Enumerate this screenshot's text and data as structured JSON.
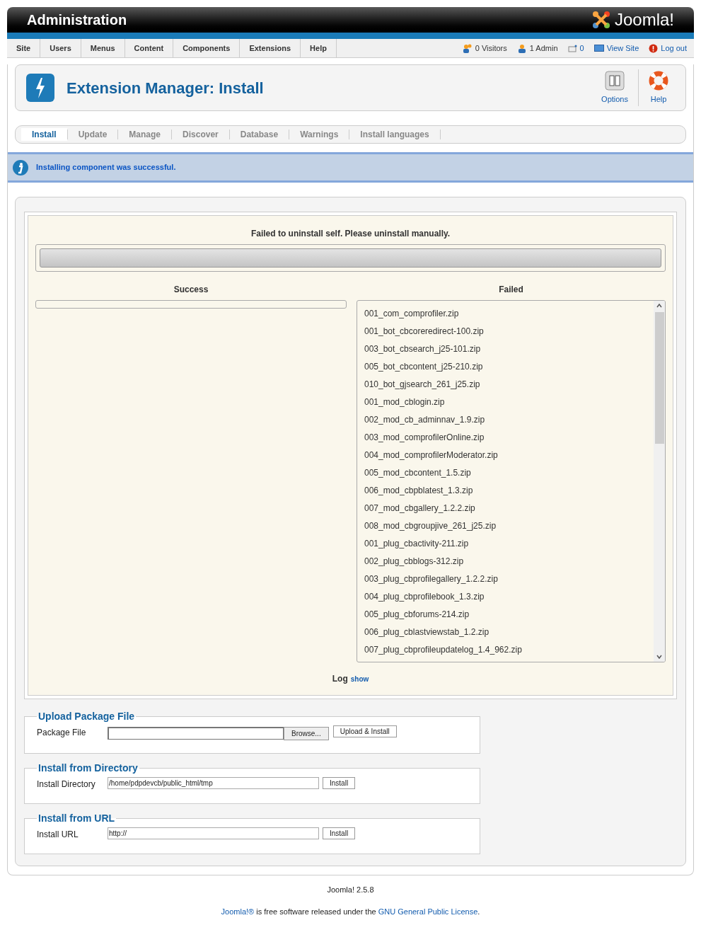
{
  "header": {
    "title": "Administration",
    "logo_text": "Joomla!"
  },
  "menu": [
    {
      "label": "Site"
    },
    {
      "label": "Users"
    },
    {
      "label": "Menus"
    },
    {
      "label": "Content"
    },
    {
      "label": "Components"
    },
    {
      "label": "Extensions"
    },
    {
      "label": "Help"
    }
  ],
  "status": [
    {
      "kind": "visitors",
      "label": "0 Visitors"
    },
    {
      "kind": "admins",
      "label": "1 Admin"
    },
    {
      "kind": "messages",
      "label": "0"
    },
    {
      "kind": "viewsite",
      "label": "View Site"
    },
    {
      "kind": "logout",
      "label": "Log out"
    }
  ],
  "toolbar": {
    "title": "Extension Manager: Install",
    "buttons": [
      {
        "kind": "options",
        "label": "Options"
      },
      {
        "kind": "help",
        "label": "Help"
      }
    ]
  },
  "tabs": [
    {
      "label": "Install",
      "selected": true
    },
    {
      "label": "Update",
      "selected": false
    },
    {
      "label": "Manage",
      "selected": false
    },
    {
      "label": "Discover",
      "selected": false
    },
    {
      "label": "Database",
      "selected": false
    },
    {
      "label": "Warnings",
      "selected": false
    },
    {
      "label": "Install languages",
      "selected": false
    }
  ],
  "message": "Installing component was successful.",
  "result": {
    "heading": "Failed to uninstall self. Please uninstall manually.",
    "progress": {
      "level": 1
    },
    "success": {
      "heading": "Success"
    },
    "failed": {
      "heading": "Failed",
      "items": [
        "001_com_comprofiler.zip",
        "001_bot_cbcoreredirect-100.zip",
        "003_bot_cbsearch_j25-101.zip",
        "005_bot_cbcontent_j25-210.zip",
        "010_bot_gjsearch_261_j25.zip",
        "001_mod_cblogin.zip",
        "002_mod_cb_adminnav_1.9.zip",
        "003_mod_comprofilerOnline.zip",
        "004_mod_comprofilerModerator.zip",
        "005_mod_cbcontent_1.5.zip",
        "006_mod_cbpblatest_1.3.zip",
        "007_mod_cbgallery_1.2.2.zip",
        "008_mod_cbgroupjive_261_j25.zip",
        "001_plug_cbactivity-211.zip",
        "002_plug_cbblogs-312.zip",
        "003_plug_cbprofilegallery_1.2.2.zip",
        "004_plug_cbprofilebook_1.3.zip",
        "005_plug_cbforums-214.zip",
        "006_plug_cblastviewstab_1.2.zip",
        "007_plug_cbprofileupdatelog_1.4_962.zip"
      ]
    },
    "log_label": "Log",
    "log_link": "show"
  },
  "sections": [
    {
      "kind": "upload",
      "legend": "Upload Package File",
      "label": "Package File",
      "browse": "Browse...",
      "button": "Upload & Install"
    },
    {
      "kind": "directory",
      "legend": "Install from Directory",
      "label": "Install Directory",
      "value": "/home/pdpdevcb/public_html/tmp",
      "button": "Install"
    },
    {
      "kind": "url",
      "legend": "Install from URL",
      "label": "Install URL",
      "value": "http://",
      "button": "Install"
    }
  ],
  "footer": {
    "version": "Joomla! 2.5.8",
    "license": {
      "link_1": "Joomla!®",
      "text": " is free software released under the ",
      "link_2": "GNU General Public License",
      "end": "."
    }
  }
}
